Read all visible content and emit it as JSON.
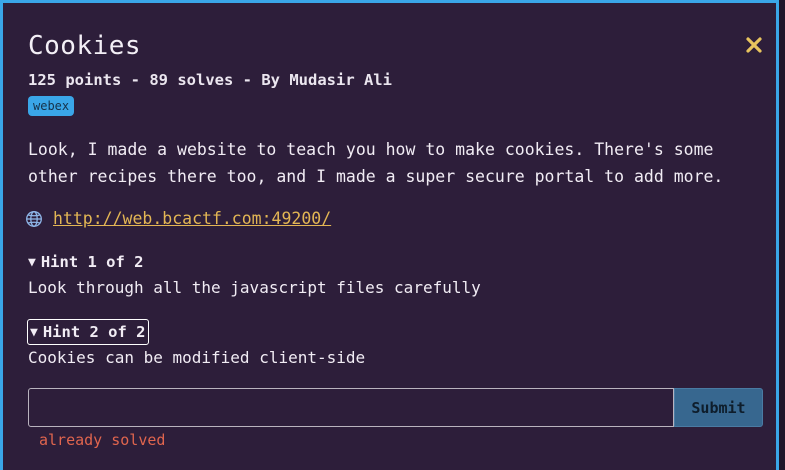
{
  "challenge": {
    "title": "Cookies",
    "points": "125 points",
    "solves": "89 solves",
    "author": "By Mudasir Ali",
    "separator": " - ",
    "tag": "webex",
    "description": "Look, I made a website to teach you how to make cookies. There's some other recipes there too, and I made a super secure portal to add more.",
    "link": "http://web.bcactf.com:49200/"
  },
  "hints": [
    {
      "label": "Hint 1 of 2",
      "text": "Look through all the javascript files carefully"
    },
    {
      "label": "Hint 2 of 2",
      "text": "Cookies can be modified client-side"
    }
  ],
  "flag_form": {
    "value": "",
    "placeholder": "",
    "submit_label": "Submit",
    "status": "already solved"
  },
  "icons": {
    "close": "close-icon",
    "link": "globe-icon",
    "disclosure": "triangle-down-icon"
  },
  "colors": {
    "accent": "#3aa6e8",
    "background": "#2d1e3a",
    "link": "#e3b654",
    "close": "#e8c45e",
    "error": "#e0654e",
    "button": "#37678f"
  }
}
